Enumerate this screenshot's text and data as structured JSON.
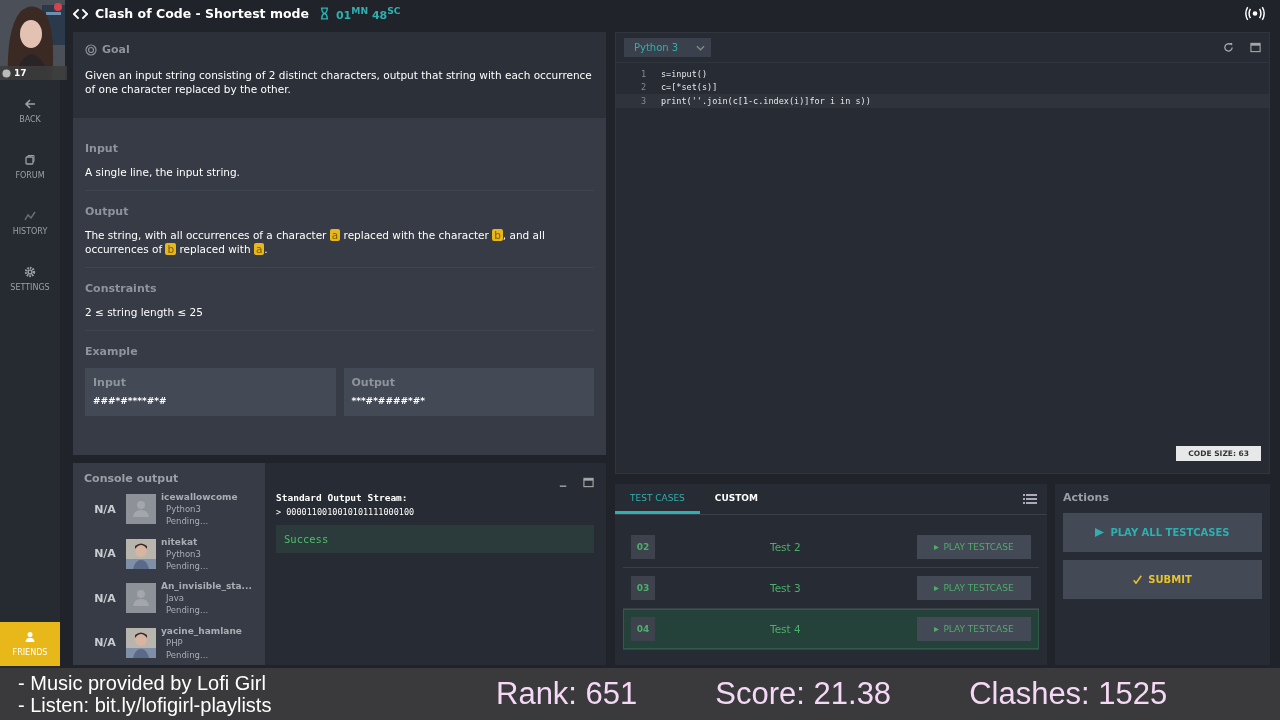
{
  "header": {
    "title": "Clash of Code - Shortest mode",
    "timer": "01$^{MN}$ 48$^{SC}$"
  },
  "webcam": {
    "kind": "picture",
    "badge": "17"
  },
  "sidebar": {
    "items": [
      {
        "label": "BACK",
        "kind": "back",
        "selected": false
      },
      {
        "label": "FORUM",
        "kind": "forum",
        "selected": false
      },
      {
        "label": "HISTORY",
        "kind": "history",
        "selected": false
      },
      {
        "label": "SETTINGS",
        "kind": "settings",
        "selected": false
      }
    ],
    "bottom_item": {
      "label": "FRIENDS",
      "kind": "friends",
      "selected": true
    }
  },
  "statement": {
    "goal_title": "Goal",
    "goal": "Given an input string consisting of 2 distinct characters, output that string with each occurrence of one character replaced by the other.",
    "sections": [
      {
        "title": "Input",
        "parts": [
          {
            "kind": "text",
            "text": "A single line, the input string."
          }
        ]
      },
      {
        "title": "Output",
        "parts": [
          {
            "kind": "text",
            "text": "The string, with all occurrences of a character"
          },
          {
            "kind": "var",
            "text": "a"
          },
          {
            "kind": "text",
            "text": "replaced with the character"
          },
          {
            "kind": "var",
            "text": "b"
          },
          {
            "kind": "text",
            "text": ", and all occurrences of"
          },
          {
            "kind": "var",
            "text": "b"
          },
          {
            "kind": "text",
            "text": "replaced with"
          },
          {
            "kind": "var",
            "text": "a"
          },
          {
            "kind": "text",
            "text": "."
          }
        ]
      },
      {
        "title": "Constraints",
        "parts": [
          {
            "kind": "text",
            "text": "2 ≤ string length ≤ 25"
          }
        ]
      }
    ],
    "example": {
      "title": "Example",
      "input_label": "Input",
      "input": "###*#****#*#",
      "output_label": "Output",
      "output": "***#*####*#*"
    }
  },
  "console": {
    "title": "Console output",
    "players": [
      {
        "rank": "N/A",
        "name": "icewallowcome",
        "language": "Python3",
        "status": "Pending...",
        "kind": "default"
      },
      {
        "rank": "N/A",
        "name": "nitekat",
        "language": "Python3",
        "status": "Pending..."
      },
      {
        "rank": "N/A",
        "name": "An_invisible_sta...",
        "language": "Java",
        "status": "Pending...",
        "kind": "default"
      },
      {
        "rank": "N/A",
        "name": "yacine_hamlane",
        "language": "PHP",
        "status": "Pending..."
      }
    ],
    "stream_label": "Standard Output Stream:",
    "stream_output": "> 0000110010010101111000100",
    "result": "Success"
  },
  "editor": {
    "language": "Python 3",
    "lines": [
      {
        "number": "1",
        "code": "s=input()"
      },
      {
        "number": "2",
        "code": "c=[*set(s)]"
      },
      {
        "number": "3",
        "code": "print(''.join(c[1-c.index(i)]for i in s))"
      }
    ],
    "code_size": "CODE SIZE:  63"
  },
  "tests": {
    "tabs": [
      {
        "label": "TEST CASES",
        "selected": true
      },
      {
        "label": "CUSTOM",
        "selected": false
      }
    ],
    "rows": [
      {
        "number": "02",
        "name": "Test 2",
        "button": "PLAY TESTCASE",
        "selected": false
      },
      {
        "number": "03",
        "name": "Test 3",
        "button": "PLAY TESTCASE",
        "selected": false
      },
      {
        "number": "04",
        "name": "Test 4",
        "button": "PLAY TESTCASE",
        "selected": true
      }
    ]
  },
  "actions": {
    "title": "Actions",
    "play_all": "PLAY ALL TESTCASES",
    "submit": "SUBMIT"
  },
  "overlay": {
    "lines": [
      "- Music provided by Lofi Girl",
      "- Listen: bit.ly/lofigirl-playlists"
    ],
    "rank": "Rank: 651",
    "score": "Score: 21.38",
    "clashes": "Clashes: 1525"
  }
}
